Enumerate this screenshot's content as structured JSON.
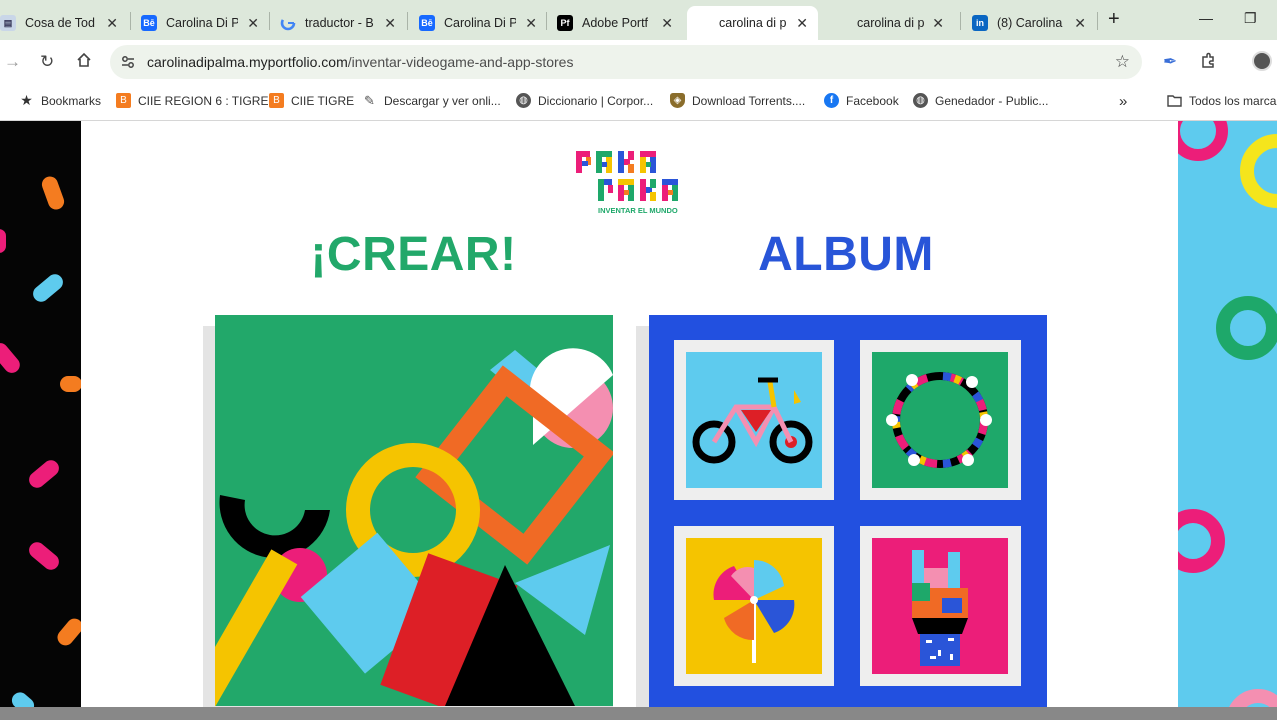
{
  "tabs": [
    {
      "label": "Cosa de Tod",
      "active": false
    },
    {
      "label": "Carolina Di P",
      "active": false
    },
    {
      "label": "traductor - B",
      "active": false
    },
    {
      "label": "Carolina Di P",
      "active": false
    },
    {
      "label": "Adobe Portf",
      "active": false
    },
    {
      "label": "carolina di p",
      "active": true
    },
    {
      "label": "carolina di p",
      "active": false
    },
    {
      "label": "(8) Carolina",
      "active": false
    }
  ],
  "toolbar": {
    "url_domain": "carolinadipalma.myportfolio.com",
    "url_path": "/inventar-videogame-and-app-stores"
  },
  "bookmarks": {
    "items": [
      {
        "label": "Bookmarks"
      },
      {
        "label": "CIIE REGION 6 : TIGRE"
      },
      {
        "label": "CIIE TIGRE"
      },
      {
        "label": "Descargar y ver onli..."
      },
      {
        "label": "Diccionario | Corpor..."
      },
      {
        "label": "Download Torrents...."
      },
      {
        "label": "Facebook"
      },
      {
        "label": "Genedador - Public..."
      }
    ],
    "all_label": "Todos los marca"
  },
  "page": {
    "logo_line1": "PAKA",
    "logo_line2": "PAKA",
    "logo_tagline": "INVENTAR EL MUNDO",
    "heading_left": "¡CREAR!",
    "heading_right": "ALBUM",
    "colors": {
      "crear_green": "#1ea86a",
      "album_blue": "#2855d8",
      "crear_bg": "#22a86a",
      "album_bg": "#2250e0"
    }
  }
}
